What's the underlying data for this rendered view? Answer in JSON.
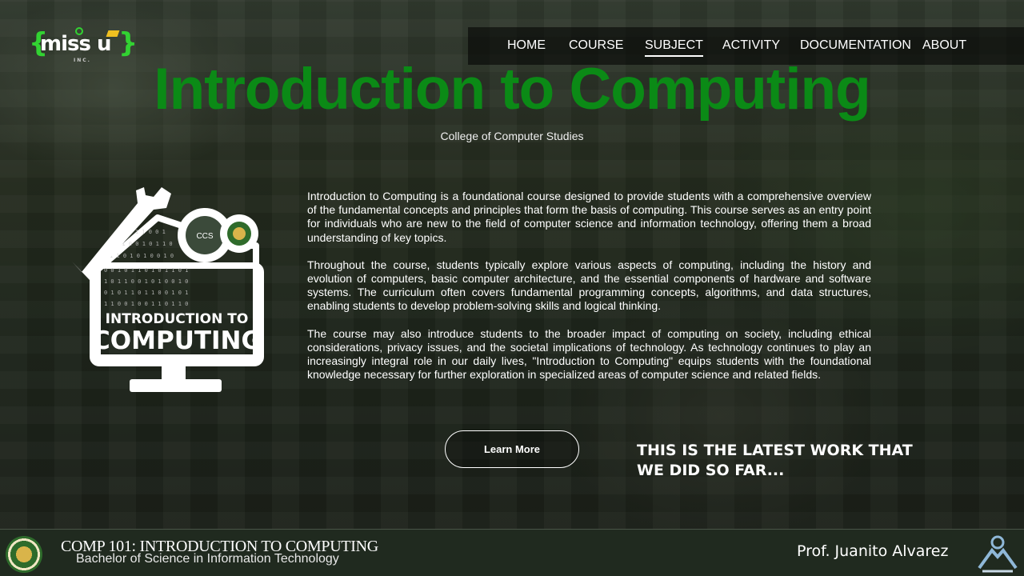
{
  "brand": {
    "logo_word": "miss u",
    "logo_sub": "INC."
  },
  "nav": {
    "items": [
      "HOME",
      "COURSE",
      "SUBJECT",
      "ACTIVITY",
      "DOCUMENTATION",
      "ABOUT"
    ],
    "active": "SUBJECT"
  },
  "hero": {
    "title": "Introduction to Computing",
    "subtitle": "College of Computer Studies"
  },
  "illustration": {
    "line1": "INTRODUCTION TO",
    "line2": "COMPUTING",
    "badge": "CCS"
  },
  "description": {
    "p1": "Introduction to Computing is a foundational course designed to provide students with a comprehensive overview of the fundamental concepts and principles that form the basis of computing. This course serves as an entry point for individuals who are new to the field of computer science and information technology, offering them a broad understanding of key topics.",
    "p2": "Throughout the course, students typically explore various aspects of computing, including the history and evolution of computers, basic computer architecture, and the essential components of hardware and software systems. The curriculum often covers fundamental programming concepts, algorithms, and data structures, enabling students to develop problem-solving skills and logical thinking.",
    "p3": "The course may also introduce students to the broader impact of computing on society, including ethical considerations, privacy issues, and the societal implications of technology. As technology continues to play an increasingly integral role in our daily lives, \"Introduction to Computing\" equips students with the foundational knowledge necessary for further exploration in specialized areas of computer science and related fields."
  },
  "cta": {
    "learn_more": "Learn More",
    "latest_work": "THIS IS THE LATEST WORK THAT WE DID SO FAR..."
  },
  "footer": {
    "course": "COMP 101: INTRODUCTION TO COMPUTING",
    "program": "Bachelor of Science in Information Technology",
    "professor": "Prof. Juanito Alvarez"
  },
  "colors": {
    "title_green": "#0b8a16",
    "logo_green": "#32d232",
    "footer_bg": "#202a1f"
  }
}
